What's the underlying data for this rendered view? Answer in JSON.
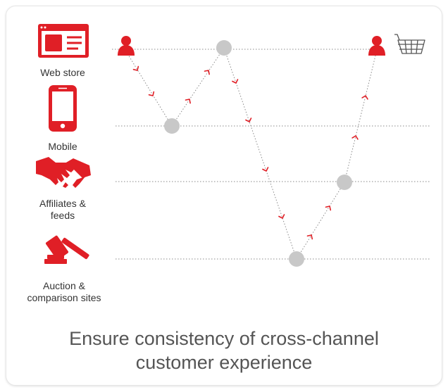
{
  "colors": {
    "accent": "#e01f26",
    "node": "#c8c8c8",
    "line": "#8a8a8a",
    "text": "#333333",
    "caption": "#555555"
  },
  "channels": [
    {
      "label": "Web store",
      "icon": "web-store-icon"
    },
    {
      "label": "Mobile",
      "icon": "mobile-phone-icon"
    },
    {
      "label": "Affiliates &\nfeeds",
      "icon": "handshake-icon"
    },
    {
      "label": "Auction &\ncomparison sites",
      "icon": "gavel-icon"
    }
  ],
  "journey": {
    "start_icon": "customer-person-icon",
    "end_icon": "customer-person-icon",
    "goal_icon": "shopping-basket-icon",
    "path_levels": [
      "Web store",
      "Mobile",
      "Web store",
      "Auction & comparison sites",
      "Affiliates & feeds",
      "Web store"
    ]
  },
  "caption": "Ensure consistency of cross-channel\ncustomer experience"
}
